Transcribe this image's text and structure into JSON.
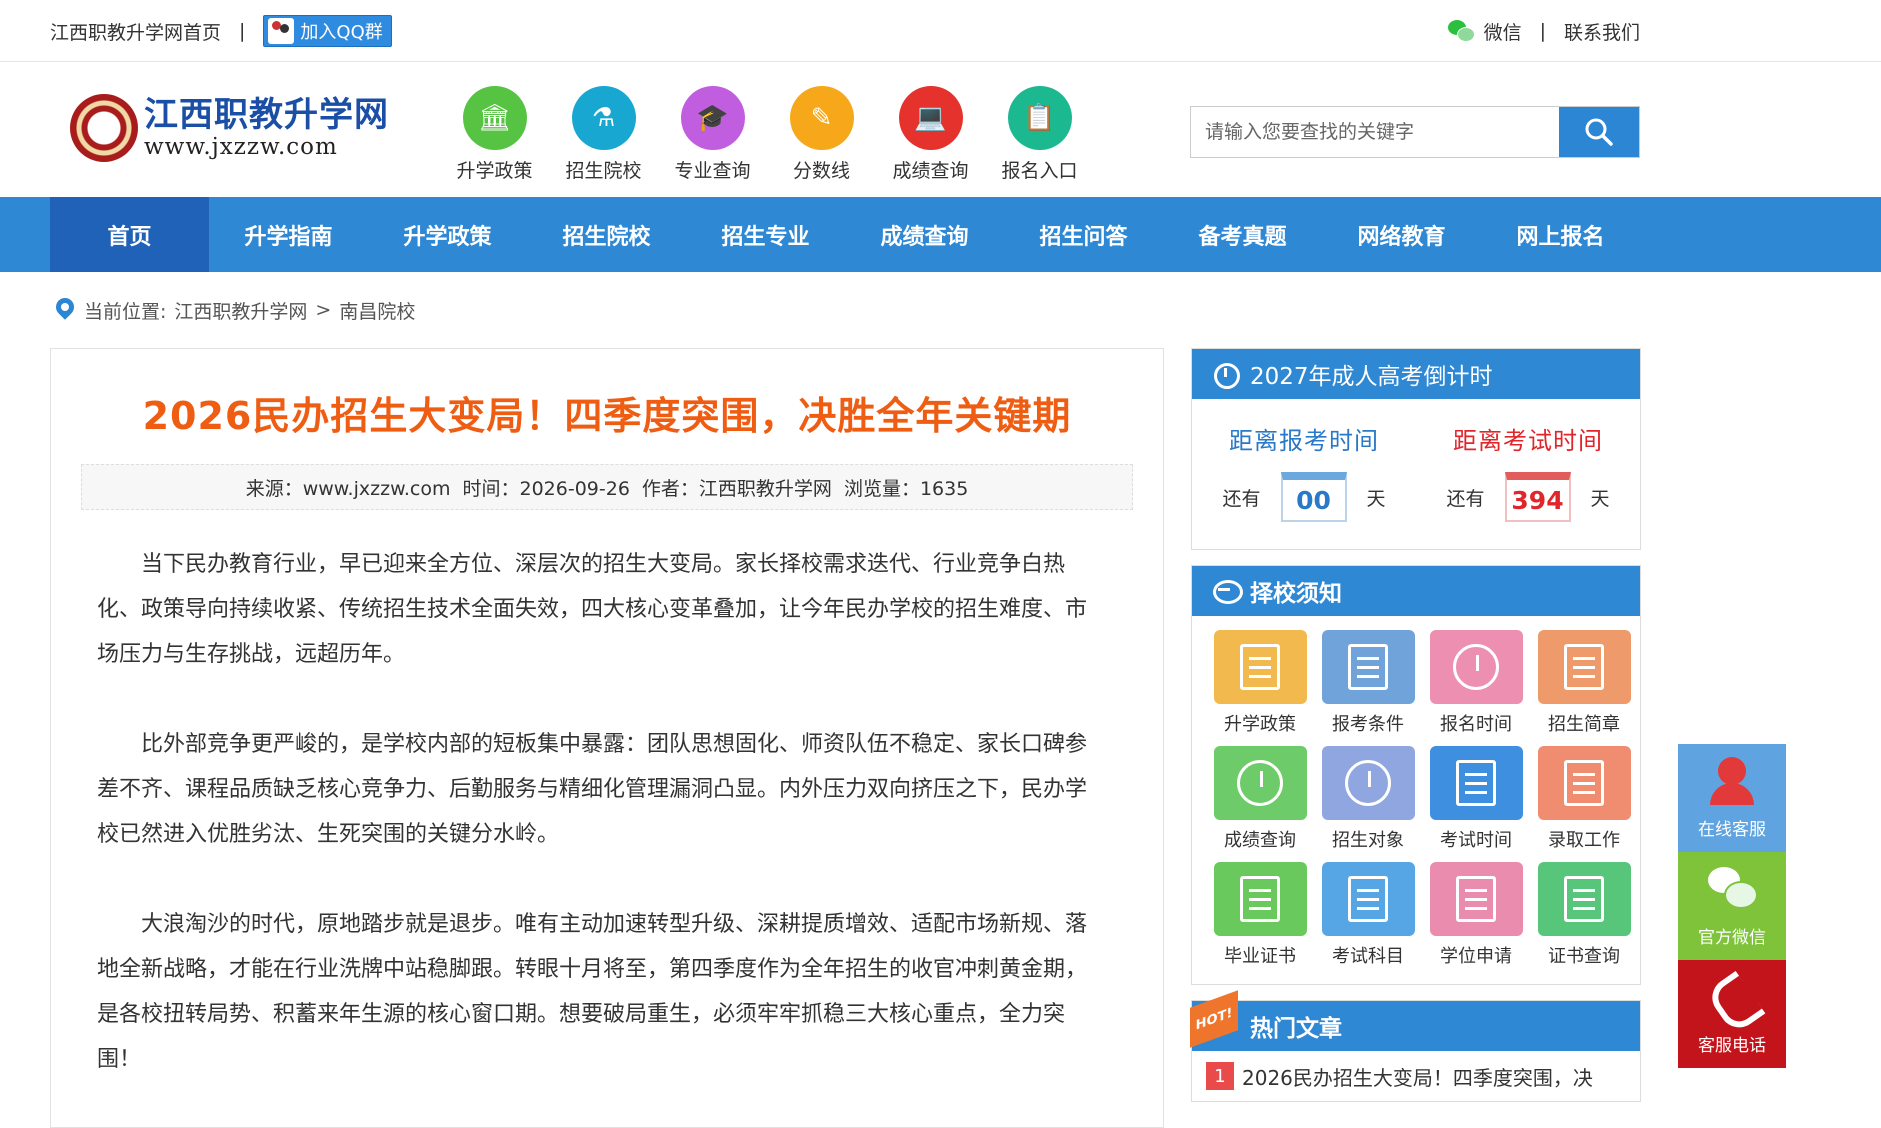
{
  "topbar": {
    "home_link": "江西职教升学网首页",
    "separator": "|",
    "qq_button": "加入QQ群",
    "wechat": "微信",
    "contact": "联系我们"
  },
  "logo": {
    "cn": "江西职教升学网",
    "en": "www.jxzzw.com"
  },
  "quicknav": [
    {
      "label": "升学政策",
      "color": "#56c343",
      "glyph": "🏛"
    },
    {
      "label": "招生院校",
      "color": "#18a7d0",
      "glyph": "⚗"
    },
    {
      "label": "专业查询",
      "color": "#c15ee0",
      "glyph": "🎓"
    },
    {
      "label": "分数线",
      "color": "#f6a81a",
      "glyph": "✎"
    },
    {
      "label": "成绩查询",
      "color": "#e5322d",
      "glyph": "💻"
    },
    {
      "label": "报名入口",
      "color": "#1cb890",
      "glyph": "📋"
    }
  ],
  "search": {
    "placeholder": "请输入您要查找的关键字"
  },
  "mainnav": [
    "首页",
    "升学指南",
    "升学政策",
    "招生院校",
    "招生专业",
    "成绩查询",
    "招生问答",
    "备考真题",
    "网络教育",
    "网上报名"
  ],
  "breadcrumb": {
    "prefix": "当前位置:",
    "site": "江西职教升学网",
    "arrow": ">",
    "current": "南昌院校"
  },
  "article": {
    "title": "2026民办招生大变局！四季度突围，决胜全年关键期",
    "meta": {
      "source": "来源：www.jxzzw.com",
      "time": "时间：2026-09-26",
      "author": "作者：江西职教升学网",
      "views": "浏览量：1635"
    },
    "paragraphs": [
      "当下民办教育行业，早已迎来全方位、深层次的招生大变局。家长择校需求迭代、行业竞争白热化、政策导向持续收紧、传统招生技术全面失效，四大核心变革叠加，让今年民办学校的招生难度、市场压力与生存挑战，远超历年。",
      "比外部竞争更严峻的，是学校内部的短板集中暴露：团队思想固化、师资队伍不稳定、家长口碑参差不齐、课程品质缺乏核心竞争力、后勤服务与精细化管理漏洞凸显。内外压力双向挤压之下，民办学校已然进入优胜劣汰、生死突围的关键分水岭。",
      "大浪淘沙的时代，原地踏步就是退步。唯有主动加速转型升级、深耕提质增效、适配市场新规、落地全新战略，才能在行业洗牌中站稳脚跟。转眼十月将至，第四季度作为全年招生的收官冲刺黄金期，是各校扭转局势、积蓄来年生源的核心窗口期。想要破局重生，必须牢牢抓稳三大核心重点，全力突围！"
    ]
  },
  "countdown": {
    "title": "2027年成人高考倒计时",
    "left_caption": "距离报考时间",
    "right_caption": "距离考试时间",
    "prefix": "还有",
    "suffix": "天",
    "left_days": "00",
    "right_days": "394"
  },
  "guide": {
    "title": "择校须知",
    "items": [
      {
        "label": "升学政策",
        "color": "#f2b94e"
      },
      {
        "label": "报考条件",
        "color": "#6fa3d9"
      },
      {
        "label": "报名时间",
        "color": "#ec8fb1"
      },
      {
        "label": "招生简章",
        "color": "#ee9a6a"
      },
      {
        "label": "成绩查询",
        "color": "#6dcb6a"
      },
      {
        "label": "招生对象",
        "color": "#8fa6e0"
      },
      {
        "label": "考试时间",
        "color": "#3e8fe0"
      },
      {
        "label": "录取工作",
        "color": "#f08c70"
      },
      {
        "label": "毕业证书",
        "color": "#6ac95c"
      },
      {
        "label": "考试科目",
        "color": "#56a6e6"
      },
      {
        "label": "学位申请",
        "color": "#e98cad"
      },
      {
        "label": "证书查询",
        "color": "#58c67a"
      }
    ]
  },
  "hot": {
    "badge": "HOT!",
    "title": "热门文章",
    "items": [
      {
        "num": "1",
        "text": "2026民办招生大变局！四季度突围，决"
      }
    ]
  },
  "float": {
    "kefu": "在线客服",
    "wechat": "官方微信",
    "phone": "客服电话"
  },
  "colors": {
    "brand_blue": "#2f88d4",
    "nav_active": "#1f62b7",
    "title_orange": "#ef5d13",
    "countdown_blue": "#2a78c8",
    "countdown_red": "#e0262b"
  }
}
